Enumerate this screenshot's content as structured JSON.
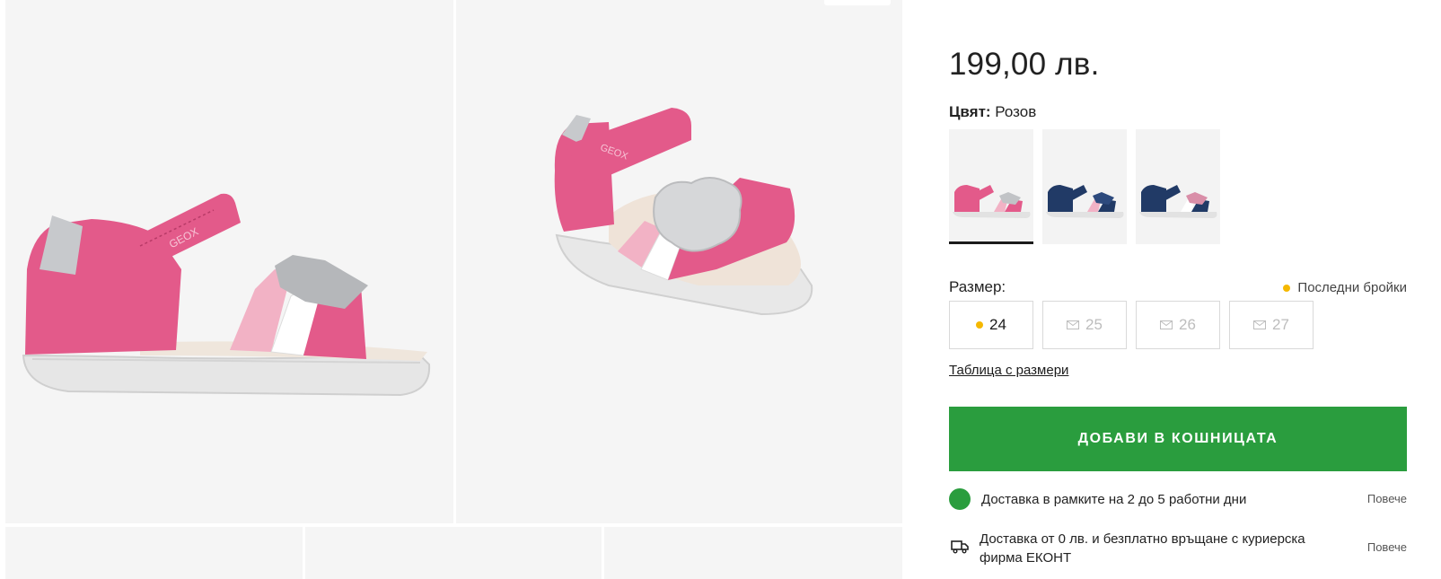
{
  "product": {
    "price": "199,00 лв.",
    "color_label": "Цвят:",
    "color_value": "Розов",
    "swatches": [
      {
        "name": "pink",
        "color": "#e65b8c"
      },
      {
        "name": "navy-pink",
        "color": "#213a66"
      },
      {
        "name": "navy-white",
        "color": "#213a66"
      }
    ],
    "size_label": "Размер:",
    "last_items_label": "Последни бройки",
    "sizes": [
      {
        "label": "24",
        "available": true
      },
      {
        "label": "25",
        "available": false
      },
      {
        "label": "26",
        "available": false
      },
      {
        "label": "27",
        "available": false
      }
    ],
    "size_table_link": "Таблица с размери",
    "add_to_cart": "ДОБАВИ В КОШНИЦАТА",
    "delivery_time": "Доставка в рамките на 2 до 5 работни дни",
    "delivery_cost": "Доставка от 0 лв. и безплатно връщане с куриерска фирма ЕКОНТ",
    "more_label": "Повече"
  },
  "gallery": {
    "brand_mark": "GEOX"
  },
  "colors": {
    "accent_green": "#2a9d3e",
    "stock_yellow": "#f5b800",
    "shoe_pink": "#e65b8c"
  }
}
